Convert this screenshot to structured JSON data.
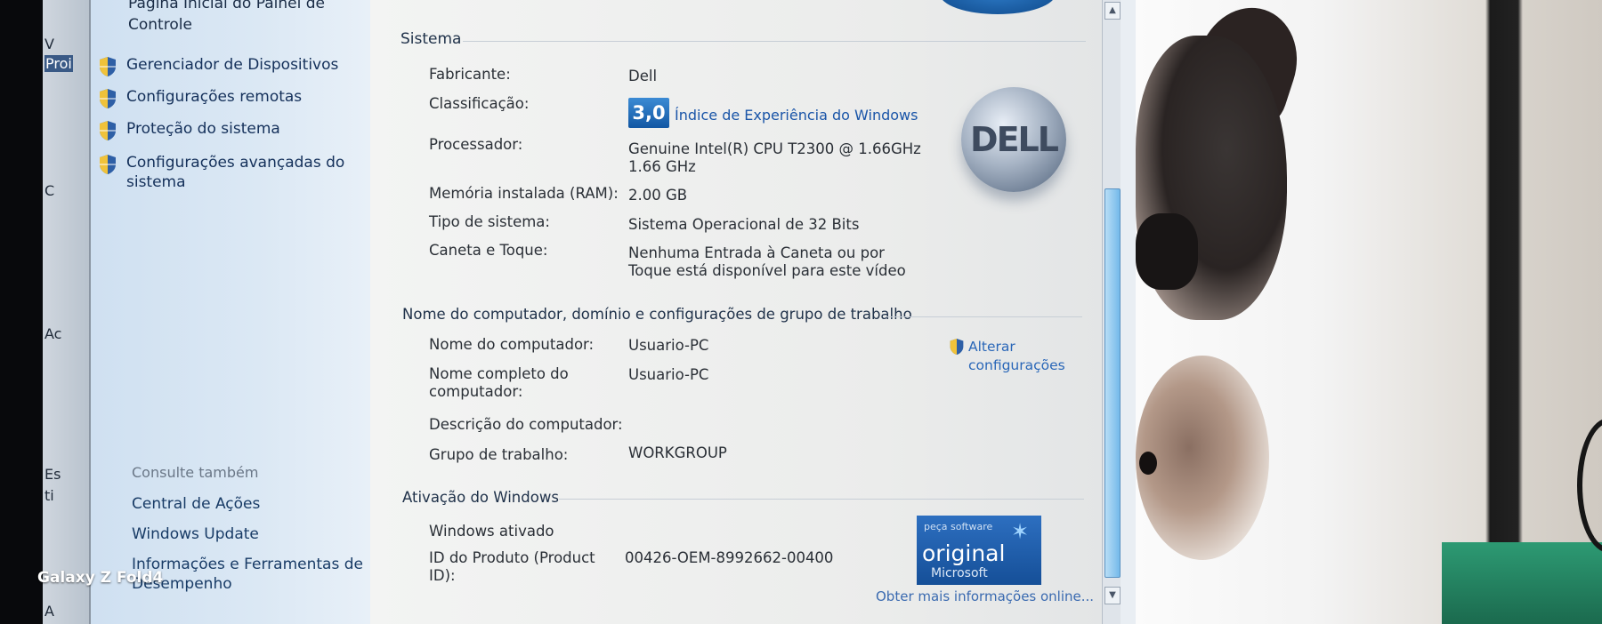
{
  "background_window": {
    "fragments": [
      "V",
      "Proi",
      "C",
      "Ac",
      "Es",
      "ti",
      "A"
    ]
  },
  "nav": {
    "home_link": "Página Inicial do Painel de Controle",
    "items": [
      {
        "label": "Gerenciador de Dispositivos",
        "icon": "shield-icon"
      },
      {
        "label": "Configurações remotas",
        "icon": "shield-icon"
      },
      {
        "label": "Proteção do sistema",
        "icon": "shield-icon"
      },
      {
        "label": "Configurações avançadas do sistema",
        "icon": "shield-icon"
      }
    ],
    "see_also_heading": "Consulte também",
    "see_also": [
      "Central de Ações",
      "Windows Update",
      "Informações e Ferramentas de Desempenho"
    ]
  },
  "system": {
    "heading": "Sistema",
    "rows": [
      {
        "label": "Fabricante:",
        "value": "Dell"
      },
      {
        "label": "Classificação:",
        "value": ""
      },
      {
        "label": "Processador:",
        "value": "Genuine Intel(R) CPU          T2300  @ 1.66GHz\n1.66 GHz"
      },
      {
        "label": "Memória instalada (RAM):",
        "value": "2.00 GB"
      },
      {
        "label": "Tipo de sistema:",
        "value": "Sistema Operacional de 32 Bits"
      },
      {
        "label": "Caneta e Toque:",
        "value": "Nenhuma Entrada à Caneta ou por Toque está disponível para este vídeo"
      }
    ],
    "wei_score": "3,0",
    "wei_link": "Índice de Experiência do Windows",
    "oem_logo": "DELL"
  },
  "computer": {
    "heading": "Nome do computador, domínio e configurações de grupo de trabalho",
    "rows": [
      {
        "label": "Nome do computador:",
        "value": "Usuario-PC"
      },
      {
        "label": "Nome completo do computador:",
        "value": "Usuario-PC"
      },
      {
        "label": "Descrição do computador:",
        "value": ""
      },
      {
        "label": "Grupo de trabalho:",
        "value": "WORKGROUP"
      }
    ],
    "change_settings": "Alterar configurações"
  },
  "activation": {
    "heading": "Ativação do Windows",
    "status": "Windows ativado",
    "product_id_label": "ID do Produto (Product ID):",
    "product_id": "00426-OEM-8992662-00400",
    "genuine_badge": {
      "line1": "peça software",
      "line2": "original",
      "line3": "Microsoft"
    },
    "more_info": "Obter mais informações online..."
  },
  "watermark": "Galaxy Z Fold4",
  "colors": {
    "link": "#1a55a8",
    "nav_bg": "#d6e5f3",
    "wei_blue": "#1257a3",
    "scroll_thumb": "#74b9ea"
  }
}
